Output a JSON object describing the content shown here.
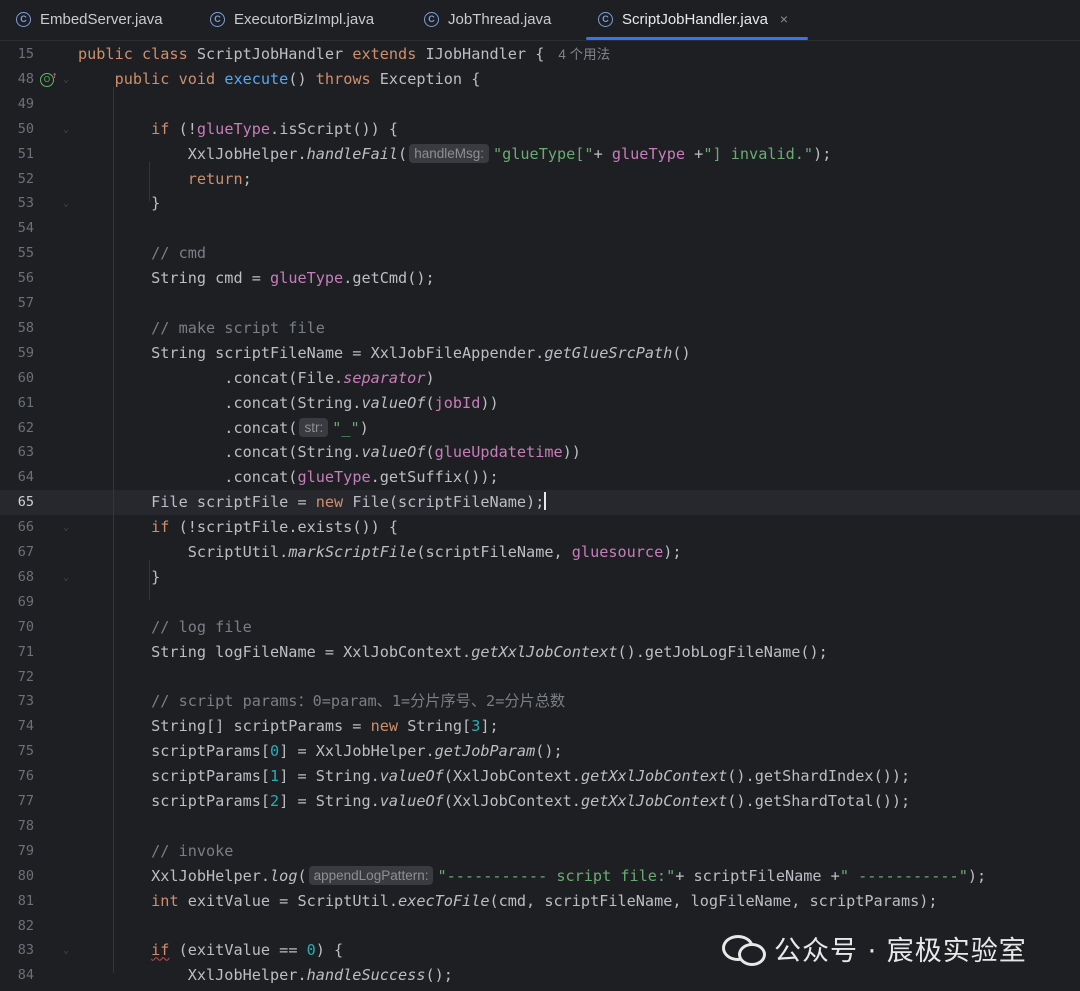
{
  "tabs": [
    {
      "label": "EmbedServer.java",
      "active": false
    },
    {
      "label": "ExecutorBizImpl.java",
      "active": false
    },
    {
      "label": "JobThread.java",
      "active": false
    },
    {
      "label": "ScriptJobHandler.java",
      "active": true
    }
  ],
  "tab_icon": "C",
  "close_glyph": "×",
  "accent_color": "#3574f0",
  "inlay_usages": "4 个用法",
  "current_line": "65",
  "lines": [
    {
      "n": "15",
      "html": "<span class=\"kw\">public class </span>ScriptJobHandler <span class=\"kw\">extends </span>IJobHandler {"
    },
    {
      "n": "48",
      "html": "    <span class=\"kw\">public void </span><span class=\"fn\">execute</span>() <span class=\"kw\">throws </span>Exception {"
    },
    {
      "n": "49",
      "html": ""
    },
    {
      "n": "50",
      "html": "        <span class=\"kw\">if </span>(!<span class=\"fld\">glueType</span>.isScript()) {"
    },
    {
      "n": "51",
      "html": "            XxlJobHelper.<span class=\"it\">handleFail</span>(<span class=\"hint\">handleMsg:</span><span class=\"str\">\"glueType[\"</span>+ <span class=\"fld\">glueType</span> +<span class=\"str\">\"] invalid.\"</span>);"
    },
    {
      "n": "52",
      "html": "            <span class=\"kw\">return</span>;"
    },
    {
      "n": "53",
      "html": "        }"
    },
    {
      "n": "54",
      "html": ""
    },
    {
      "n": "55",
      "html": "        <span class=\"cmt\">// cmd</span>"
    },
    {
      "n": "56",
      "html": "        String cmd = <span class=\"fld\">glueType</span>.getCmd();"
    },
    {
      "n": "57",
      "html": ""
    },
    {
      "n": "58",
      "html": "        <span class=\"cmt\">// make script file</span>"
    },
    {
      "n": "59",
      "html": "        String scriptFileName = XxlJobFileAppender.<span class=\"it\">getGlueSrcPath</span>()"
    },
    {
      "n": "60",
      "html": "                .concat(File.<span class=\"fld it\">separator</span>)"
    },
    {
      "n": "61",
      "html": "                .concat(String.<span class=\"it\">valueOf</span>(<span class=\"fld\">jobId</span>))"
    },
    {
      "n": "62",
      "html": "                .concat(<span class=\"hint\">str:</span><span class=\"str\">\"_\"</span>)"
    },
    {
      "n": "63",
      "html": "                .concat(String.<span class=\"it\">valueOf</span>(<span class=\"fld\">glueUpdatetime</span>))"
    },
    {
      "n": "64",
      "html": "                .concat(<span class=\"fld\">glueType</span>.getSuffix());"
    },
    {
      "n": "65",
      "html": "        File scriptFile = <span class=\"kw\">new </span>File(scriptFileName);<span class=\"caret\"></span>"
    },
    {
      "n": "66",
      "html": "        <span class=\"kw\">if </span>(!scriptFile.exists()) {"
    },
    {
      "n": "67",
      "html": "            ScriptUtil.<span class=\"it\">markScriptFile</span>(scriptFileName, <span class=\"fld\">gluesource</span>);"
    },
    {
      "n": "68",
      "html": "        }"
    },
    {
      "n": "69",
      "html": ""
    },
    {
      "n": "70",
      "html": "        <span class=\"cmt\">// log file</span>"
    },
    {
      "n": "71",
      "html": "        String logFileName = XxlJobContext.<span class=\"it\">getXxlJobContext</span>().getJobLogFileName();"
    },
    {
      "n": "72",
      "html": ""
    },
    {
      "n": "73",
      "html": "        <span class=\"cmt\">// script params：0=param、1=分片序号、2=分片总数</span>"
    },
    {
      "n": "74",
      "html": "        String[] scriptParams = <span class=\"kw\">new </span>String[<span class=\"num\">3</span>];"
    },
    {
      "n": "75",
      "html": "        scriptParams[<span class=\"num\">0</span>] = XxlJobHelper.<span class=\"it\">getJobParam</span>();"
    },
    {
      "n": "76",
      "html": "        scriptParams[<span class=\"num\">1</span>] = String.<span class=\"it\">valueOf</span>(XxlJobContext.<span class=\"it\">getXxlJobContext</span>().getShardIndex());"
    },
    {
      "n": "77",
      "html": "        scriptParams[<span class=\"num\">2</span>] = String.<span class=\"it\">valueOf</span>(XxlJobContext.<span class=\"it\">getXxlJobContext</span>().getShardTotal());"
    },
    {
      "n": "78",
      "html": ""
    },
    {
      "n": "79",
      "html": "        <span class=\"cmt\">// invoke</span>"
    },
    {
      "n": "80",
      "html": "        XxlJobHelper.<span class=\"it\">log</span>(<span class=\"hint\">appendLogPattern:</span><span class=\"str\">\"----------- script file:\"</span>+ scriptFileName +<span class=\"str\">\" -----------\"</span>);"
    },
    {
      "n": "81",
      "html": "        <span class=\"kw\">int </span>exitValue = ScriptUtil.<span class=\"it\">execToFile</span>(cmd, scriptFileName, logFileName, scriptParams);"
    },
    {
      "n": "82",
      "html": ""
    },
    {
      "n": "83",
      "html": "        <span class=\"kw squiggle\">if</span> (exitValue == <span class=\"num\">0</span>) {"
    },
    {
      "n": "84",
      "html": "            XxlJobHelper.<span class=\"it\">handleSuccess</span>();"
    }
  ],
  "watermark": "公众号 · 宸极实验室"
}
